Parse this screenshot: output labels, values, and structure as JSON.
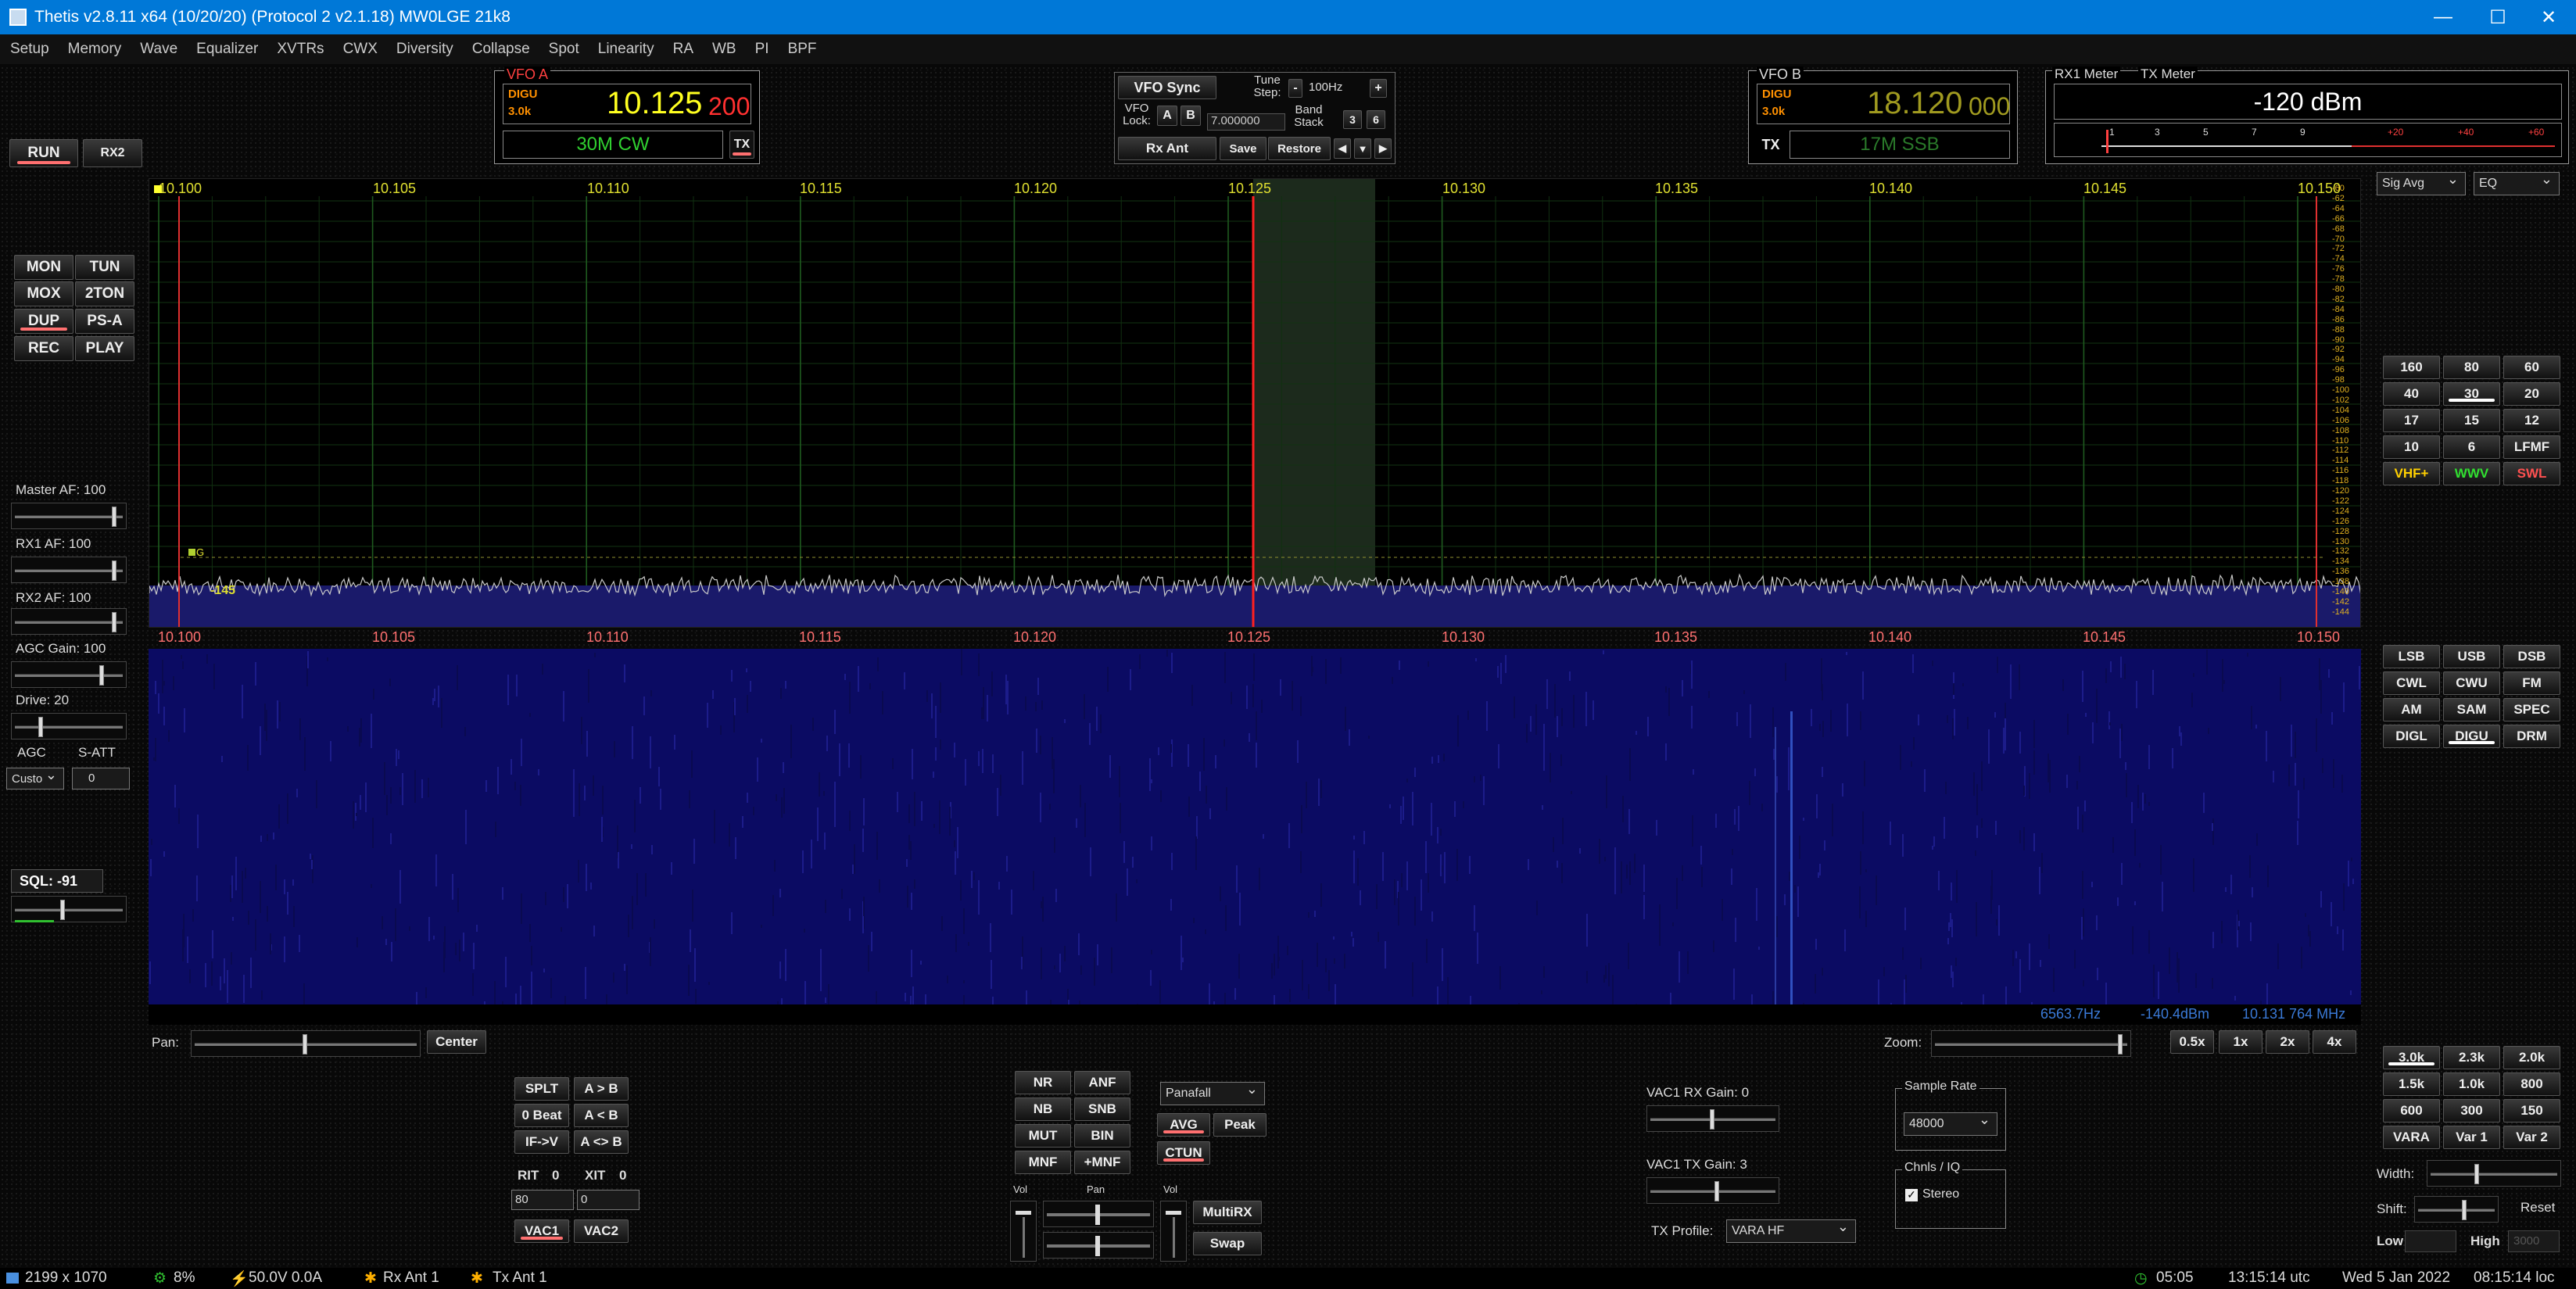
{
  "window": {
    "title": "Thetis v2.8.11 x64 (10/20/20) (Protocol 2 v2.1.18) MW0LGE 21k8",
    "minimize": "—",
    "maximize": "☐",
    "close": "✕"
  },
  "menu": [
    "Setup",
    "Memory",
    "Wave",
    "Equalizer",
    "XVTRs",
    "CWX",
    "Diversity",
    "Collapse",
    "Spot",
    "Linearity",
    "RA",
    "WB",
    "PI",
    "BPF"
  ],
  "top_buttons": {
    "run": "RUN",
    "rx2": "RX2"
  },
  "vfoa": {
    "label": "VFO A",
    "mode": "DIGU",
    "filter": "3.0k",
    "freq_main": "10.125",
    "freq_sub": "200",
    "band": "30M CW",
    "tx": "TX"
  },
  "vfob": {
    "label": "VFO B",
    "mode": "DIGU",
    "filter": "3.0k",
    "freq_main": "18.120",
    "freq_sub": "000",
    "band": "17M SSB",
    "tx": "TX"
  },
  "center": {
    "vfo_sync": "VFO Sync",
    "tune_step_label": "Tune Step:",
    "minus": "-",
    "step": "100Hz",
    "plus": "+",
    "vfo_lock": "VFO Lock:",
    "a": "A",
    "b": "B",
    "lock_freq": "7.000000",
    "band_stack": "Band Stack",
    "bs1": "3",
    "bs2": "6",
    "rx_ant": "Rx Ant",
    "save": "Save",
    "restore": "Restore",
    "prev": "◀",
    "down": "▼",
    "next": "▶"
  },
  "meter": {
    "rx_label": "RX1 Meter",
    "tx_label": "TX Meter",
    "value": "-120 dBm",
    "scale": [
      "1",
      "3",
      "5",
      "7",
      "9",
      "+20",
      "+40",
      "+60"
    ],
    "select1": "Sig Avg",
    "select2": "EQ"
  },
  "left": {
    "mon": "MON",
    "tun": "TUN",
    "mox": "MOX",
    "twotone": "2TON",
    "dup": "DUP",
    "psa": "PS-A",
    "rec": "REC",
    "play": "PLAY",
    "master_af": "Master AF:  100",
    "rx1_af": "RX1 AF:  100",
    "rx2_af": "RX2 AF:  100",
    "agc_gain": "AGC Gain:  100",
    "drive": "Drive:  20",
    "agc": "AGC",
    "satt": "S-ATT",
    "agc_mode": "Custo",
    "satt_val": "0",
    "sql": "SQL: -91"
  },
  "spectrum": {
    "ticks": [
      "10.100",
      "10.105",
      "10.110",
      "10.115",
      "10.120",
      "10.125",
      "10.130",
      "10.135",
      "10.140",
      "10.145",
      "10.150"
    ],
    "db_scale": [
      "-60",
      "-62",
      "-64",
      "-66",
      "-68",
      "-70",
      "-72",
      "-74",
      "-76",
      "-78",
      "-80",
      "-82",
      "-84",
      "-86",
      "-88",
      "-90",
      "-92",
      "-94",
      "-96",
      "-98",
      "-100",
      "-102",
      "-104",
      "-106",
      "-108",
      "-110",
      "-112",
      "-114",
      "-116",
      "-118",
      "-120",
      "-122",
      "-124",
      "-126",
      "-128",
      "-130",
      "-132",
      "-134",
      "-136",
      "-138",
      "-140",
      "-142",
      "-144"
    ],
    "marker_g": "G",
    "marker_145": "-145"
  },
  "waterfall_info": {
    "hz": "6563.7Hz",
    "dbm": "-140.4dBm",
    "mhz": "10.131 764 MHz"
  },
  "bands": [
    "160",
    "80",
    "60",
    "40",
    "30",
    "20",
    "17",
    "15",
    "12",
    "10",
    "6",
    "LFMF",
    "VHF+",
    "WWV",
    "SWL"
  ],
  "modes": [
    "LSB",
    "USB",
    "DSB",
    "CWL",
    "CWU",
    "FM",
    "AM",
    "SAM",
    "SPEC",
    "DIGL",
    "DIGU",
    "DRM"
  ],
  "filters": [
    "3.0k",
    "2.3k",
    "2.0k",
    "1.5k",
    "1.0k",
    "800",
    "600",
    "300",
    "150",
    "VARA",
    "Var 1",
    "Var 2"
  ],
  "filter_ctl": {
    "width": "Width:",
    "shift": "Shift:",
    "reset": "Reset",
    "low": "Low",
    "high": "High",
    "high_val": "3000"
  },
  "bottom": {
    "pan": "Pan:",
    "center": "Center",
    "zoom": "Zoom:",
    "z05": "0.5x",
    "z1": "1x",
    "z2": "2x",
    "z4": "4x",
    "splt": "SPLT",
    "atob": "A > B",
    "zerobeat": "0 Beat",
    "btoa": "A < B",
    "ifv": "IF->V",
    "aswap": "A <> B",
    "rit": "RIT",
    "rit_val": "0",
    "xit": "XIT",
    "xit_val": "0",
    "rit_num": "80",
    "xit_num": "0",
    "vac1": "VAC1",
    "vac2": "VAC2",
    "nr": "NR",
    "anf": "ANF",
    "nb": "NB",
    "snb": "SNB",
    "mut": "MUT",
    "bin": "BIN",
    "mnf": "MNF",
    "pmnf": "+MNF",
    "display_mode": "Panafall",
    "avg": "AVG",
    "peak": "Peak",
    "ctun": "CTUN",
    "vol": "Vol",
    "pan2": "Pan",
    "vol2": "Vol",
    "multirx": "MultiRX",
    "swap": "Swap",
    "vac1_rx": "VAC1 RX Gain: 0",
    "vac1_tx": "VAC1 TX Gain: 3",
    "txprofile": "TX Profile:",
    "txprofile_val": "VARA HF",
    "sample_rate": "Sample Rate",
    "sr_val": "48000",
    "chnls": "Chnls / IQ",
    "stereo": "Stereo"
  },
  "status": {
    "res": "2199 x 1070",
    "cpu": "8%",
    "volt": "50.0V  0.0A",
    "rxant": "Rx Ant 1",
    "txant": "Tx Ant 1",
    "uptime": "05:05",
    "utc": "13:15:14 utc",
    "date": "Wed 5 Jan 2022",
    "loc": "08:15:14 loc"
  }
}
